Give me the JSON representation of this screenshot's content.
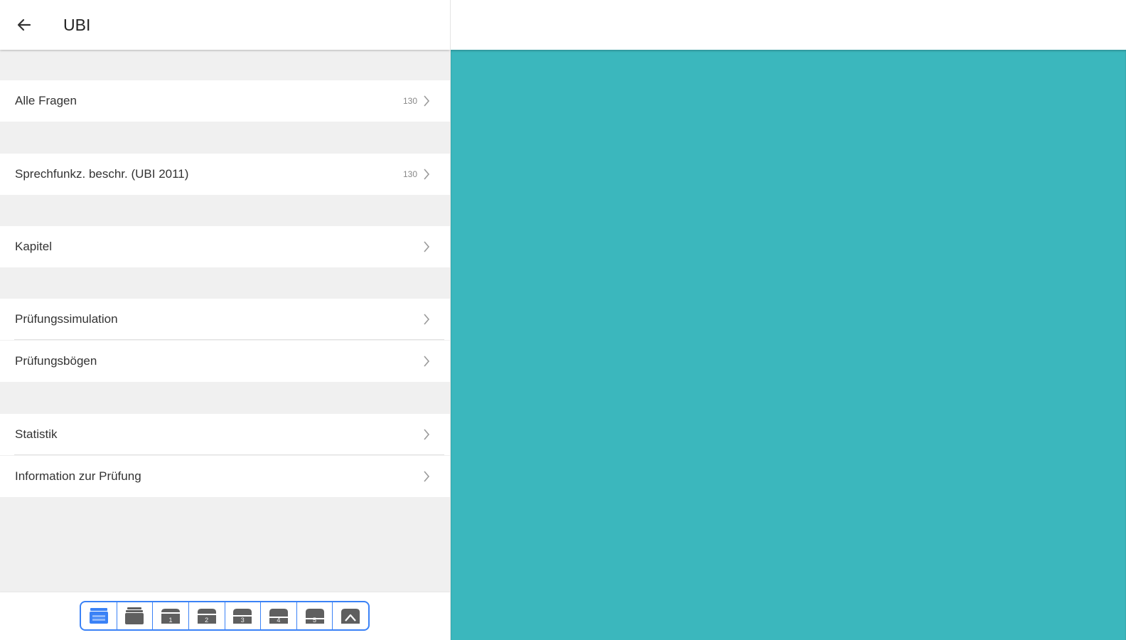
{
  "app": {
    "title": "UBI"
  },
  "menu": [
    {
      "label": "Alle Fragen",
      "count": "130"
    },
    {
      "label": "Sprechfunkz. beschr. (UBI 2011)",
      "count": "130"
    },
    {
      "label": "Kapitel"
    },
    {
      "label": "Prüfungssimulation"
    },
    {
      "label": "Prüfungsbögen"
    },
    {
      "label": "Statistik"
    },
    {
      "label": "Information zur Prüfung"
    }
  ],
  "toolbar": {
    "buttons": [
      {
        "icon": "all-boxes-icon",
        "label": "",
        "selected": true
      },
      {
        "icon": "box-stack-icon",
        "label": ""
      },
      {
        "icon": "box-1-icon",
        "label": "1"
      },
      {
        "icon": "box-2-icon",
        "label": "2"
      },
      {
        "icon": "box-3-icon",
        "label": "3"
      },
      {
        "icon": "box-4-icon",
        "label": "4"
      },
      {
        "icon": "box-5-icon",
        "label": "5"
      },
      {
        "icon": "box-top-icon",
        "label": ""
      }
    ]
  },
  "colors": {
    "accent": "#3b82f6",
    "detail_background": "#3bb7bd",
    "list_background": "#f0f0f0",
    "icon_gray": "#5f5f5f"
  }
}
